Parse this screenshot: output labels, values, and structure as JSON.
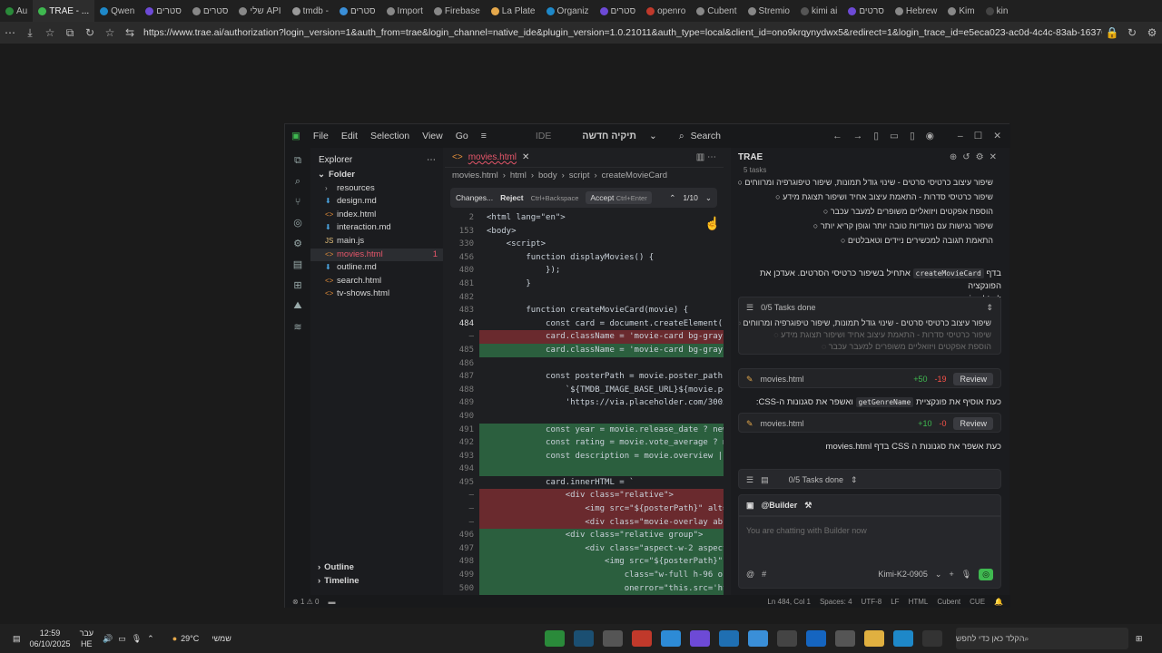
{
  "browser": {
    "tabs": [
      "Au",
      "TRAE - ...",
      "Qwen",
      "סטרים",
      "סטרים",
      "שלי API",
      "tmdb -",
      "סטרים",
      "Import",
      "Firebase",
      "La Plate",
      "Organiz",
      "סטרים",
      "openro",
      "Cubent",
      "Stremio",
      "kimi ai",
      "סרטים",
      "Hebrew",
      "Kim",
      "kin"
    ],
    "url": "https://www.trae.ai/authorization?login_version=1&auth_from=trae&login_channel=native_ide&plugin_version=1.0.21011&auth_type=local&client_id=ono9krqynydwx5&redirect=1&login_trace_id=e5eca023-ac0d-4c4c-83ab-163708fe6f..."
  },
  "ide": {
    "menu": [
      "File",
      "Edit",
      "Selection",
      "View",
      "Go"
    ],
    "ide_label": "IDE",
    "project_name": "תיקיה חדשה",
    "search_placeholder": "Search",
    "explorer": {
      "title": "Explorer",
      "folder": "Folder",
      "items": [
        {
          "name": "resources",
          "type": "folder"
        },
        {
          "name": "design.md",
          "type": "md"
        },
        {
          "name": "index.html",
          "type": "html"
        },
        {
          "name": "interaction.md",
          "type": "md"
        },
        {
          "name": "main.js",
          "type": "js"
        },
        {
          "name": "movies.html",
          "type": "html",
          "selected": true,
          "badge": "1"
        },
        {
          "name": "outline.md",
          "type": "md"
        },
        {
          "name": "search.html",
          "type": "html"
        },
        {
          "name": "tv-shows.html",
          "type": "html"
        }
      ],
      "outline": "Outline",
      "timeline": "Timeline"
    },
    "editor": {
      "tab": "movies.html",
      "breadcrumb": [
        "movies.html",
        "html",
        "body",
        "script",
        "createMovieCard"
      ],
      "diffbar": {
        "changes": "Changes...",
        "reject": "Reject",
        "reject_key": "Ctrl+Backspace",
        "accept": "Accept",
        "accept_key": "Ctrl+Enter",
        "counter": "1/10"
      },
      "lines": [
        {
          "n": "2",
          "t": "<html lang=\"en\">",
          "k": ""
        },
        {
          "n": "153",
          "t": "<body>",
          "k": ""
        },
        {
          "n": "330",
          "t": "    <script>",
          "k": ""
        },
        {
          "n": "456",
          "t": "        function displayMovies() {",
          "k": ""
        },
        {
          "n": "480",
          "t": "            });",
          "k": ""
        },
        {
          "n": "481",
          "t": "        }",
          "k": ""
        },
        {
          "n": "482",
          "t": "",
          "k": ""
        },
        {
          "n": "483",
          "t": "        function createMovieCard(movie) {",
          "k": ""
        },
        {
          "n": "484",
          "t": "            const card = document.createElement('d",
          "k": "cur"
        },
        {
          "n": "",
          "t": "            card.className = 'movie-card bg-gray-8",
          "k": "del"
        },
        {
          "n": "485",
          "t": "            card.className = 'movie-card bg-gray-8",
          "k": "add"
        },
        {
          "n": "486",
          "t": "",
          "k": ""
        },
        {
          "n": "487",
          "t": "            const posterPath = movie.poster_path ?",
          "k": ""
        },
        {
          "n": "488",
          "t": "                `${TMDB_IMAGE_BASE_URL}${movie.pos",
          "k": ""
        },
        {
          "n": "489",
          "t": "                'https://via.placeholder.com/300x4",
          "k": ""
        },
        {
          "n": "490",
          "t": "",
          "k": ""
        },
        {
          "n": "491",
          "t": "            const year = movie.release_date ? new",
          "k": "add"
        },
        {
          "n": "492",
          "t": "            const rating = movie.vote_average ? mo",
          "k": "add"
        },
        {
          "n": "493",
          "t": "            const description = movie.overview ||",
          "k": "add"
        },
        {
          "n": "494",
          "t": "",
          "k": "add"
        },
        {
          "n": "495",
          "t": "            card.innerHTML = `",
          "k": ""
        },
        {
          "n": "",
          "t": "                <div class=\"relative\">",
          "k": "del"
        },
        {
          "n": "",
          "t": "                    <img src=\"${posterPath}\" alt=\"",
          "k": "del"
        },
        {
          "n": "",
          "t": "                    <div class=\"movie-overlay abso",
          "k": "del"
        },
        {
          "n": "496",
          "t": "                <div class=\"relative group\">",
          "k": "add"
        },
        {
          "n": "497",
          "t": "                    <div class=\"aspect-w-2 aspect-",
          "k": "add"
        },
        {
          "n": "498",
          "t": "                        <img src=\"${posterPath}\" a",
          "k": "add"
        },
        {
          "n": "499",
          "t": "                            class=\"w-full h-96 ob",
          "k": "add"
        },
        {
          "n": "500",
          "t": "                            onerror=\"this.src='htt",
          "k": "add"
        }
      ]
    },
    "chat": {
      "title": "TRAE",
      "tasks_top_label": "5 tasks",
      "tasks_top": [
        "שיפור עיצוב כרטיסי סרטים - שינוי גודל תמונות, שיפור טיפוגרפיה ומרווחים",
        "שיפור כרטיסי סדרות - התאמת עיצוב אחיד ושיפור תצוגת מידע",
        "הוספת אפקטים ויזואליים משופרים למעבר עכבר",
        "שיפור נגישות עם ניגודיות טובה יותר וגופן קריא יותר",
        "התאמת תגובה למכשירים ניידים וטאבלטים"
      ],
      "msg1_pre": "בדף",
      "msg1_code": "createMovieCard",
      "msg1_post": "אתחיל בשיפור כרטיסי הסרטים. אעדכן את הפונקציה",
      "msg1_line2": "movies.html:",
      "progress_label": "0/5 Tasks done",
      "progress_tasks": [
        {
          "t": "שיפור עיצוב כרטיסי סרטים - שינוי גודל תמונות, שיפור טיפוגרפיה ומרווחים",
          "dim": false
        },
        {
          "t": "שיפור כרטיסי סדרות - התאמת עיצוב אחיד ושיפור תצוגת מידע",
          "dim": true
        },
        {
          "t": "הוספת אפקטים ויזואליים משופרים למעבר עכבר",
          "dim": true
        }
      ],
      "file1": {
        "name": "movies.html",
        "plus": "+50",
        "minus": "-19",
        "review": "Review"
      },
      "msg2_pre": "כעת אוסיף את פונקציית",
      "msg2_code": "getGenreName",
      "msg2_post": "ואשפר את סגנונות ה-CSS:",
      "file2": {
        "name": "movies.html",
        "plus": "+10",
        "minus": "-0",
        "review": "Review"
      },
      "msg3": "כעת אשפר את סגנונות ה CSS בדף movies.html",
      "bottom_progress": "0/5 Tasks done",
      "agent": "@Builder",
      "input_placeholder": "You are chatting with Builder now",
      "model": "Kimi-K2-0905"
    },
    "status": {
      "errors": "1",
      "warnings": "0",
      "position": "Ln 484, Col 1",
      "spaces": "Spaces: 4",
      "encoding": "UTF-8",
      "eol": "LF",
      "lang": "HTML",
      "ext1": "Cubent",
      "ext2": "CUE"
    }
  },
  "taskbar": {
    "time": "12:59",
    "date": "06/10/2025",
    "lang1": "עבר",
    "lang2": "HE",
    "weather_temp": "29°C",
    "weather_text": "שמשי",
    "search_placeholder": "הקלד כאן כדי לחפש"
  }
}
